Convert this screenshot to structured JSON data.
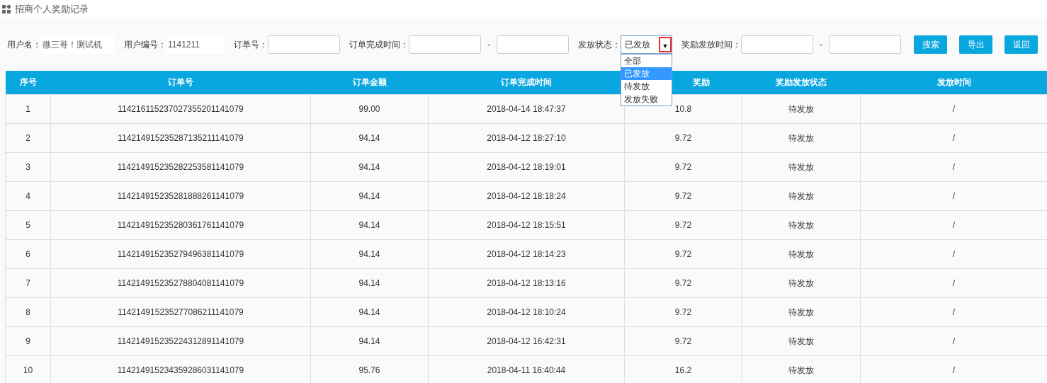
{
  "page_title": "招商个人奖励记录",
  "filters": {
    "user_name": {
      "label": "用户名：",
      "value": "微三哥！测试机"
    },
    "user_id": {
      "label": "用户编号：",
      "value": "1141211"
    },
    "order_no": {
      "label": "订单号："
    },
    "order_time": {
      "label": "订单完成时间：",
      "separator": "-"
    },
    "status": {
      "label": "发放状态：",
      "value": "已发放",
      "arrow": "▼",
      "expanded": true,
      "options": [
        {
          "label": "全部",
          "selected": false
        },
        {
          "label": "已发放",
          "selected": true
        },
        {
          "label": "待发放",
          "selected": false
        },
        {
          "label": "发放失败",
          "selected": false
        }
      ]
    },
    "reward_time": {
      "label": "奖励发放时间：",
      "separator": "-"
    }
  },
  "buttons": [
    "搜索",
    "导出",
    "返回"
  ],
  "table": {
    "columns": [
      "序号",
      "订单号",
      "订单金额",
      "订单完成时间",
      "奖励",
      "奖励发放状态",
      "发放时间"
    ],
    "rows": [
      [
        "1",
        "114216115237027355201141079",
        "99.00",
        "2018-04-14 18:47:37",
        "10.8",
        "待发放",
        "/"
      ],
      [
        "2",
        "114214915235287135211141079",
        "94.14",
        "2018-04-12 18:27:10",
        "9.72",
        "待发放",
        "/"
      ],
      [
        "3",
        "114214915235282253581141079",
        "94.14",
        "2018-04-12 18:19:01",
        "9.72",
        "待发放",
        "/"
      ],
      [
        "4",
        "114214915235281888261141079",
        "94.14",
        "2018-04-12 18:18:24",
        "9.72",
        "待发放",
        "/"
      ],
      [
        "5",
        "114214915235280361761141079",
        "94.14",
        "2018-04-12 18:15:51",
        "9.72",
        "待发放",
        "/"
      ],
      [
        "6",
        "114214915235279496381141079",
        "94.14",
        "2018-04-12 18:14:23",
        "9.72",
        "待发放",
        "/"
      ],
      [
        "7",
        "114214915235278804081141079",
        "94.14",
        "2018-04-12 18:13:16",
        "9.72",
        "待发放",
        "/"
      ],
      [
        "8",
        "114214915235277086211141079",
        "94.14",
        "2018-04-12 18:10:24",
        "9.72",
        "待发放",
        "/"
      ],
      [
        "9",
        "114214915235224312891141079",
        "94.14",
        "2018-04-12 16:42:31",
        "9.72",
        "待发放",
        "/"
      ],
      [
        "10",
        "114214915234359286031141079",
        "95.76",
        "2018-04-11 16:40:44",
        "16.2",
        "待发放",
        "/"
      ]
    ]
  }
}
